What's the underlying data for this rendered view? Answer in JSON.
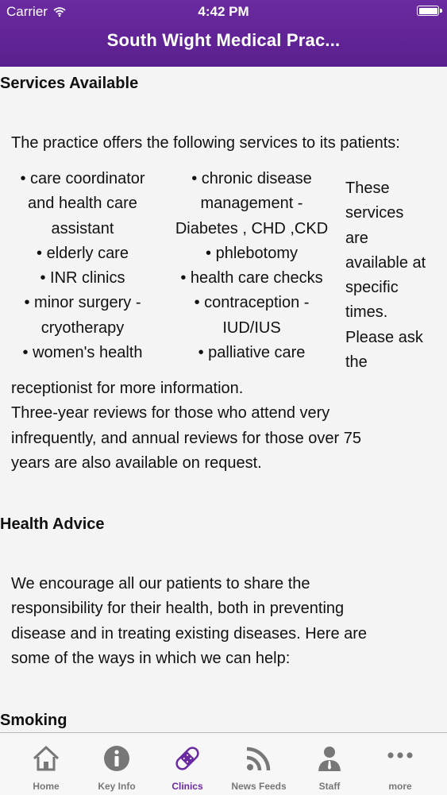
{
  "status_bar": {
    "carrier": "Carrier",
    "time": "4:42 PM"
  },
  "nav": {
    "title": "South Wight Medical Prac..."
  },
  "services": {
    "heading": "Services Available",
    "intro": "The practice offers the following services to its patients:",
    "col1": [
      "• care coordinator",
      "and health care",
      "assistant",
      "• elderly care",
      "• INR clinics",
      "• minor surgery -",
      "cryotherapy",
      "• women's health"
    ],
    "col2": [
      "• chronic disease",
      "management -",
      "Diabetes , CHD ,CKD",
      "• phlebotomy",
      "• health care checks",
      "• contraception -",
      "IUD/IUS",
      "• palliative care"
    ],
    "side": [
      "These",
      "services",
      "are",
      "available at",
      "specific",
      "times.",
      "Please ask",
      "the"
    ],
    "after": [
      "receptionist for more information.",
      "Three-year reviews for those who attend very",
      "infrequently, and annual reviews for those over 75",
      "years are also available on request."
    ]
  },
  "health_advice": {
    "heading": "Health Advice",
    "lines": [
      "We encourage all our patients to share the",
      "responsibility for their health, both in preventing",
      "disease and in treating existing diseases. Here are",
      "some of the ways in which we can help:"
    ]
  },
  "smoking": {
    "heading": "Smoking"
  },
  "tabs": [
    {
      "label": "Home",
      "icon": "home-icon"
    },
    {
      "label": "Key Info",
      "icon": "info-icon"
    },
    {
      "label": "Clinics",
      "icon": "bandage-icon",
      "active": true
    },
    {
      "label": "News Feeds",
      "icon": "rss-icon"
    },
    {
      "label": "Staff",
      "icon": "person-icon"
    },
    {
      "label": "more",
      "icon": "more-icon"
    }
  ],
  "colors": {
    "accent": "#6a2aa0",
    "tab_inactive": "#777777"
  }
}
